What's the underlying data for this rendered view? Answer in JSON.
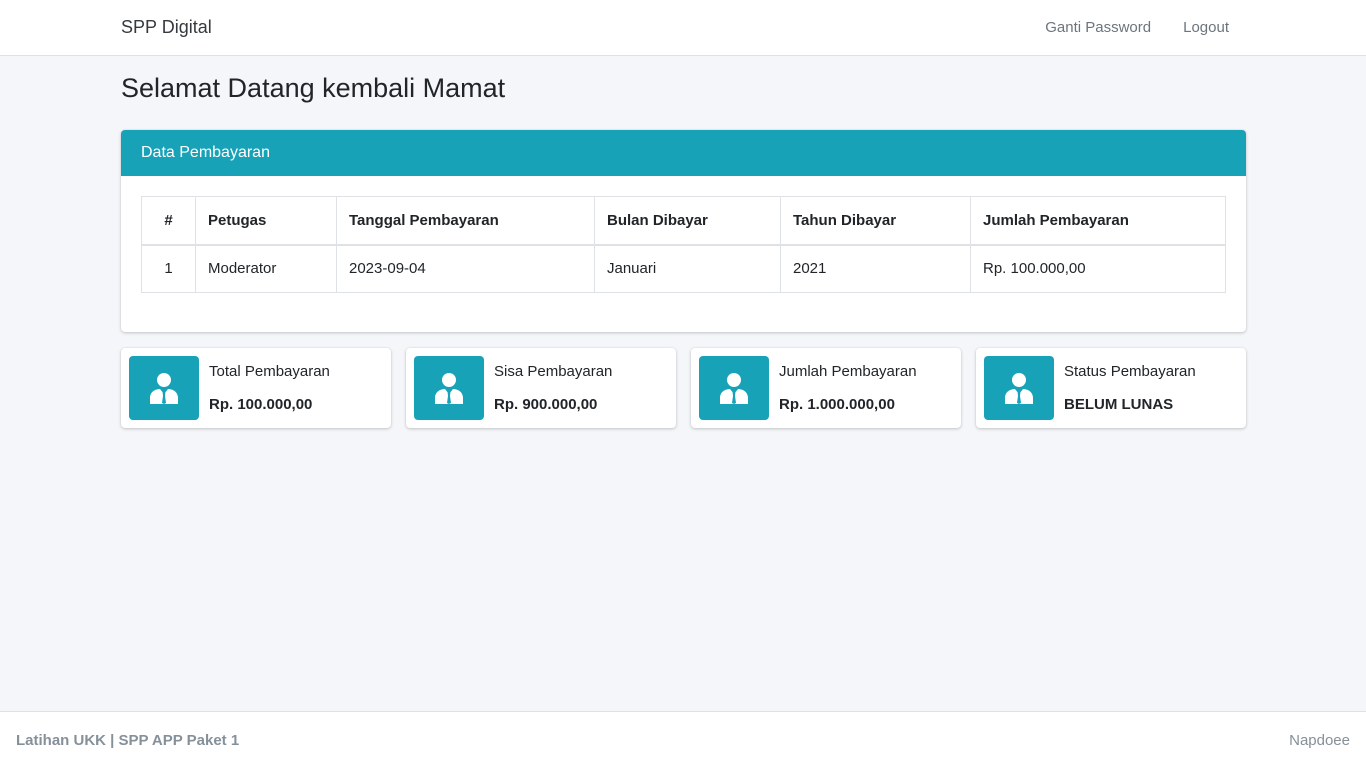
{
  "navbar": {
    "brand": "SPP Digital",
    "links": [
      {
        "label": "Ganti Password"
      },
      {
        "label": "Logout"
      }
    ]
  },
  "page_title": "Selamat Datang kembali Mamat",
  "payment_card": {
    "title": "Data Pembayaran",
    "columns": [
      "#",
      "Petugas",
      "Tanggal Pembayaran",
      "Bulan Dibayar",
      "Tahun Dibayar",
      "Jumlah Pembayaran"
    ],
    "rows": [
      [
        "1",
        "Moderator",
        "2023-09-04",
        "Januari",
        "2021",
        "Rp. 100.000,00"
      ]
    ]
  },
  "info_boxes": [
    {
      "label": "Total Pembayaran",
      "value": "Rp. 100.000,00",
      "icon": "user-tie-icon"
    },
    {
      "label": "Sisa Pembayaran",
      "value": "Rp. 900.000,00",
      "icon": "user-tie-icon"
    },
    {
      "label": "Jumlah Pembayaran",
      "value": "Rp. 1.000.000,00",
      "icon": "user-tie-icon"
    },
    {
      "label": "Status Pembayaran",
      "value": "BELUM LUNAS",
      "icon": "user-tie-icon"
    }
  ],
  "footer": {
    "left": "Latihan UKK | SPP APP Paket 1",
    "right": "Napdoee"
  },
  "colors": {
    "accent": "#17a2b8",
    "background": "#f4f6f9"
  }
}
